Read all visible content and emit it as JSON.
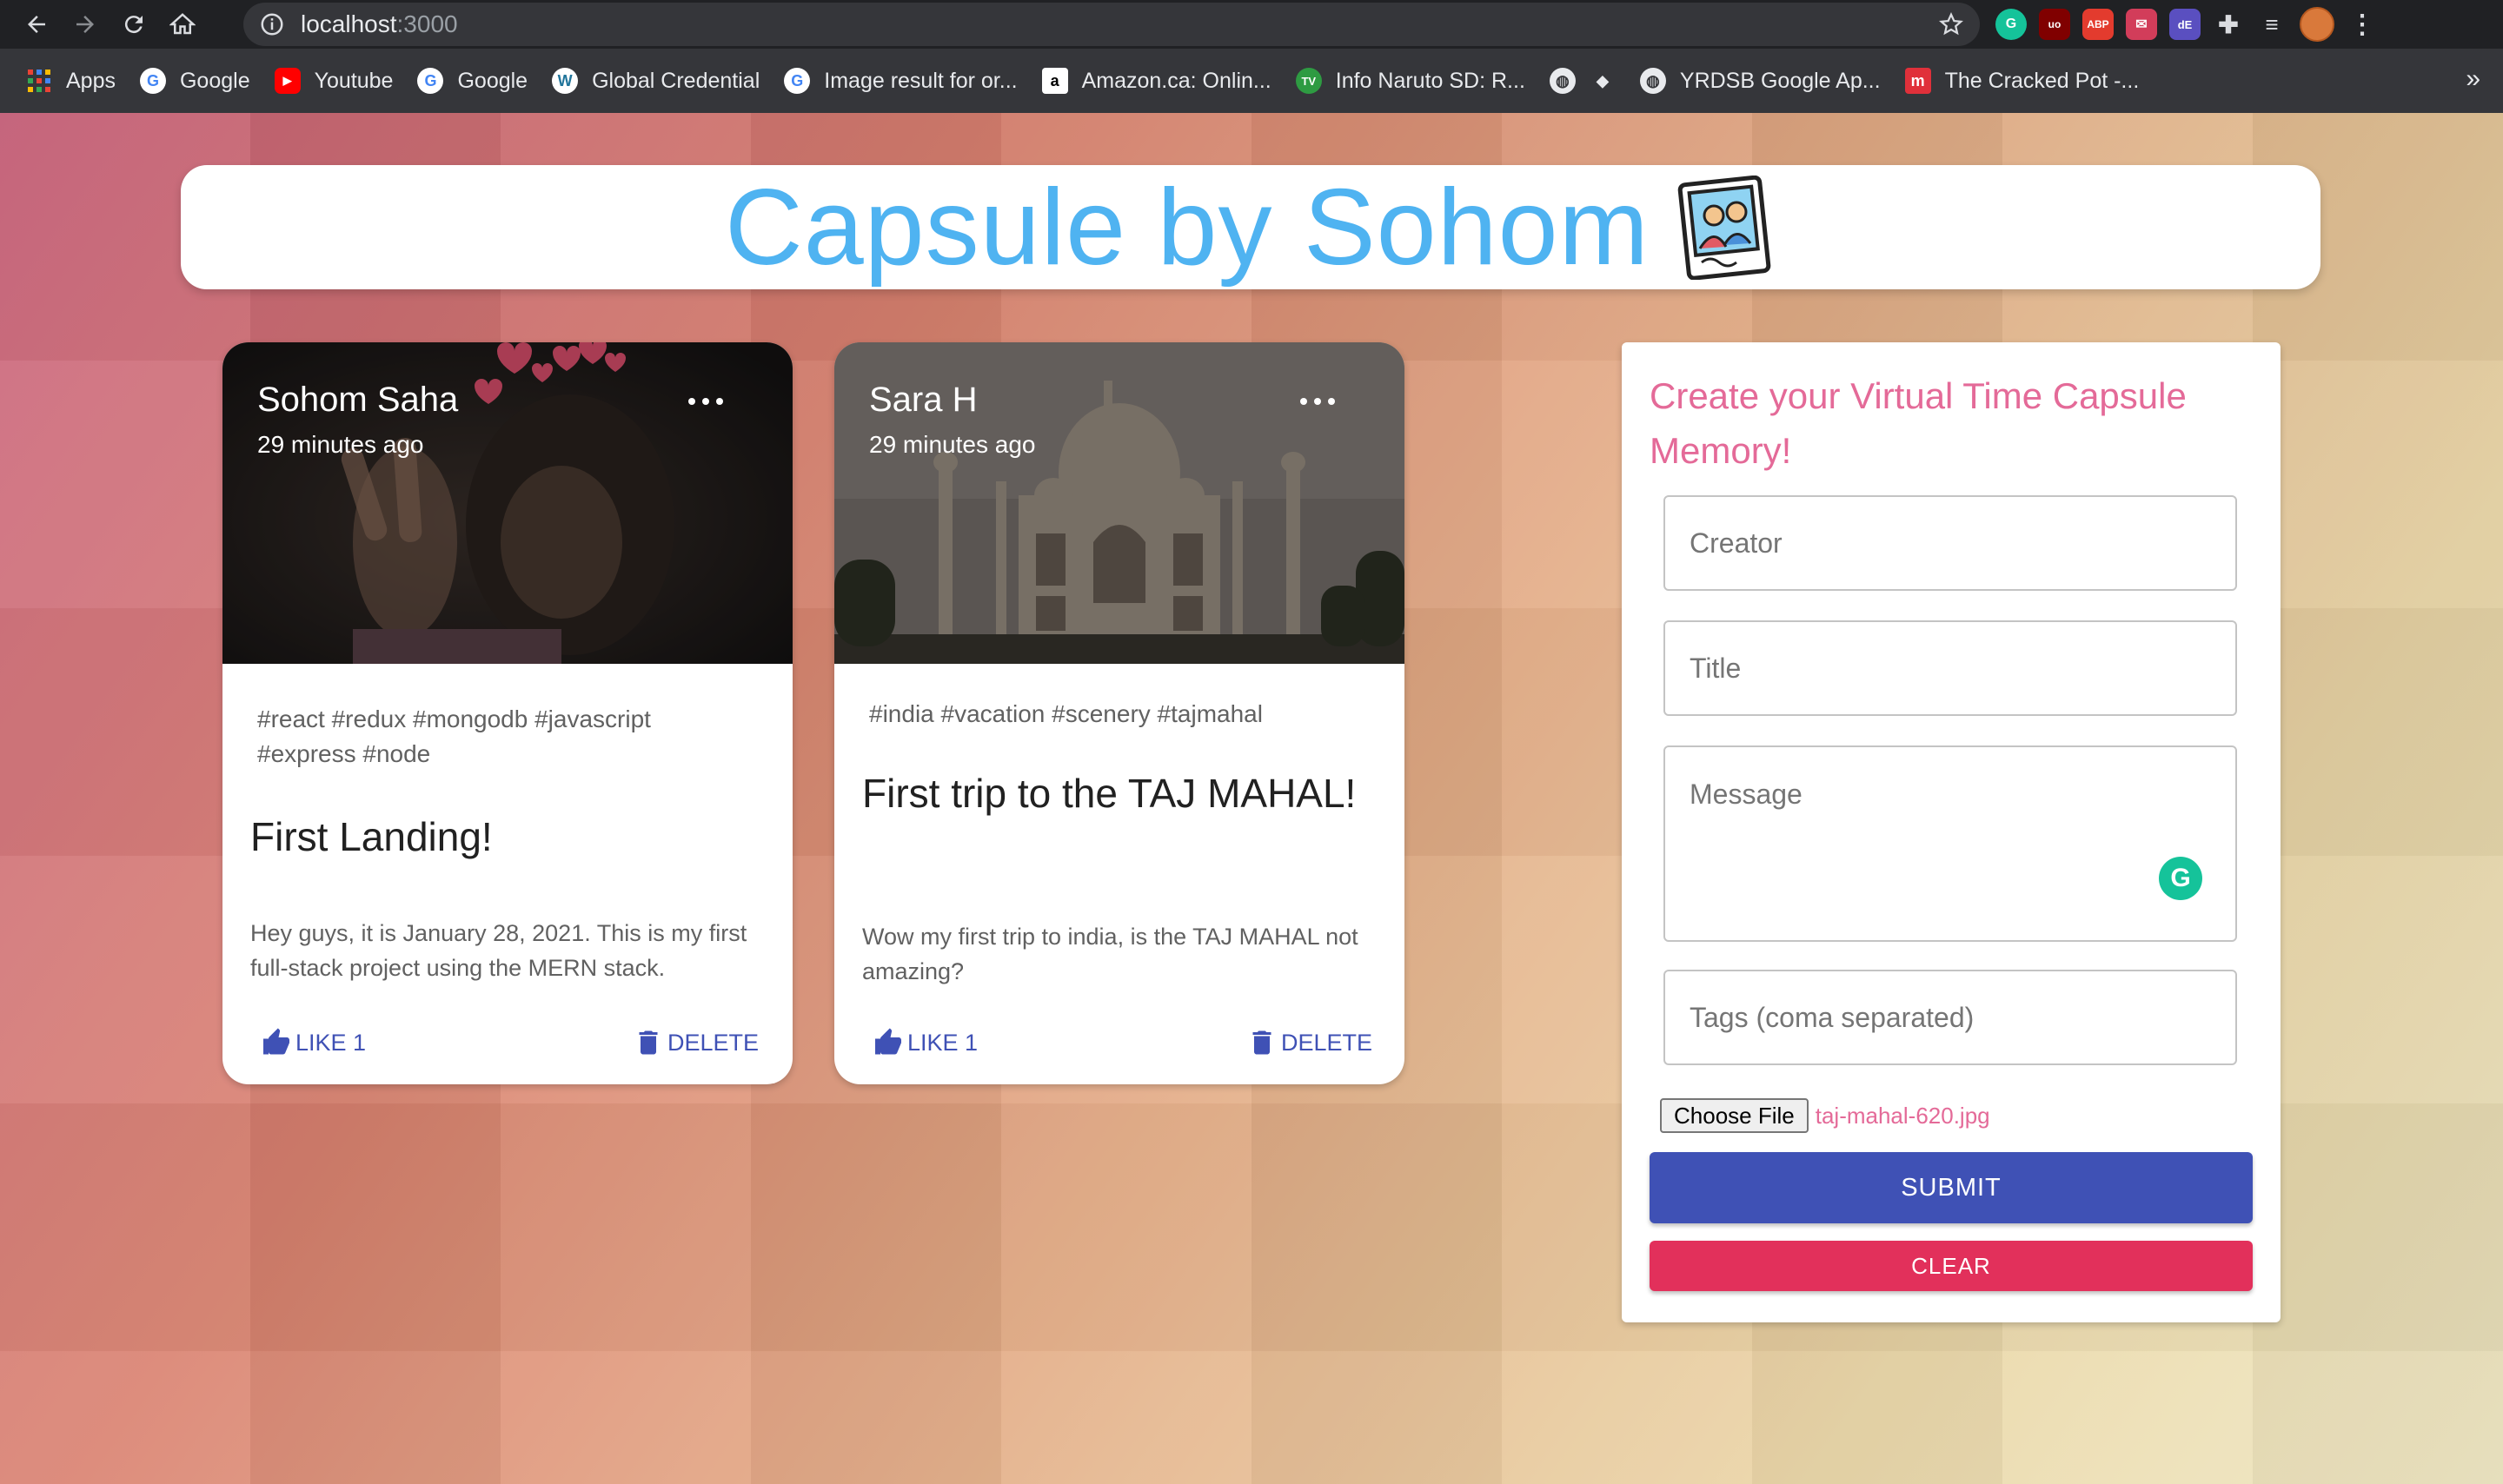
{
  "browser": {
    "url_host": "localhost",
    "url_port": ":3000",
    "bookmarks": [
      {
        "label": "Apps",
        "icon": "apps-grid-icon"
      },
      {
        "label": "Google",
        "icon": "google-icon"
      },
      {
        "label": "Youtube",
        "icon": "youtube-icon"
      },
      {
        "label": "Google",
        "icon": "google-icon"
      },
      {
        "label": "Global Credential",
        "icon": "wordpress-icon"
      },
      {
        "label": "Image result for or...",
        "icon": "google-icon"
      },
      {
        "label": "Amazon.ca: Onlin...",
        "icon": "amazon-icon"
      },
      {
        "label": "Info Naruto SD: R...",
        "icon": "tv-icon"
      },
      {
        "label": "",
        "icon": "globe-icon"
      },
      {
        "label": "YRDSB Google Ap...",
        "icon": "globe-icon"
      },
      {
        "label": "The Cracked Pot -...",
        "icon": "m-icon"
      }
    ],
    "overflow": "»"
  },
  "app": {
    "title": "Capsule by Sohom",
    "logo_icon": "memories-photo-icon",
    "title_color": "#4fb3f1"
  },
  "posts": [
    {
      "creator": "Sohom Saha",
      "time": "29 minutes ago",
      "tags": "#react #redux #mongodb #javascript #express #node",
      "title": "First Landing!",
      "message": "Hey guys, it is January 28, 2021. This is my first full-stack project using the MERN stack.",
      "like_label": "LIKE 1",
      "delete_label": "DELETE"
    },
    {
      "creator": "Sara H",
      "time": "29 minutes ago",
      "tags": "#india #vacation #scenery #tajmahal",
      "title": "First trip to the TAJ MAHAL!",
      "message": "Wow my first trip to india, is the TAJ MAHAL not amazing?",
      "like_label": "LIKE 1",
      "delete_label": "DELETE"
    }
  ],
  "form": {
    "title": "Create your Virtual Time Capsule Memory!",
    "creator_placeholder": "Creator",
    "title_placeholder": "Title",
    "message_placeholder": "Message",
    "tags_placeholder": "Tags (coma separated)",
    "choose_file_label": "Choose File",
    "file_name": "taj-mahal-620.jpg",
    "submit_label": "SUBMIT",
    "clear_label": "CLEAR",
    "accent_color": "#e46a98",
    "submit_color": "#3f51b5",
    "clear_color": "#e2305b"
  }
}
